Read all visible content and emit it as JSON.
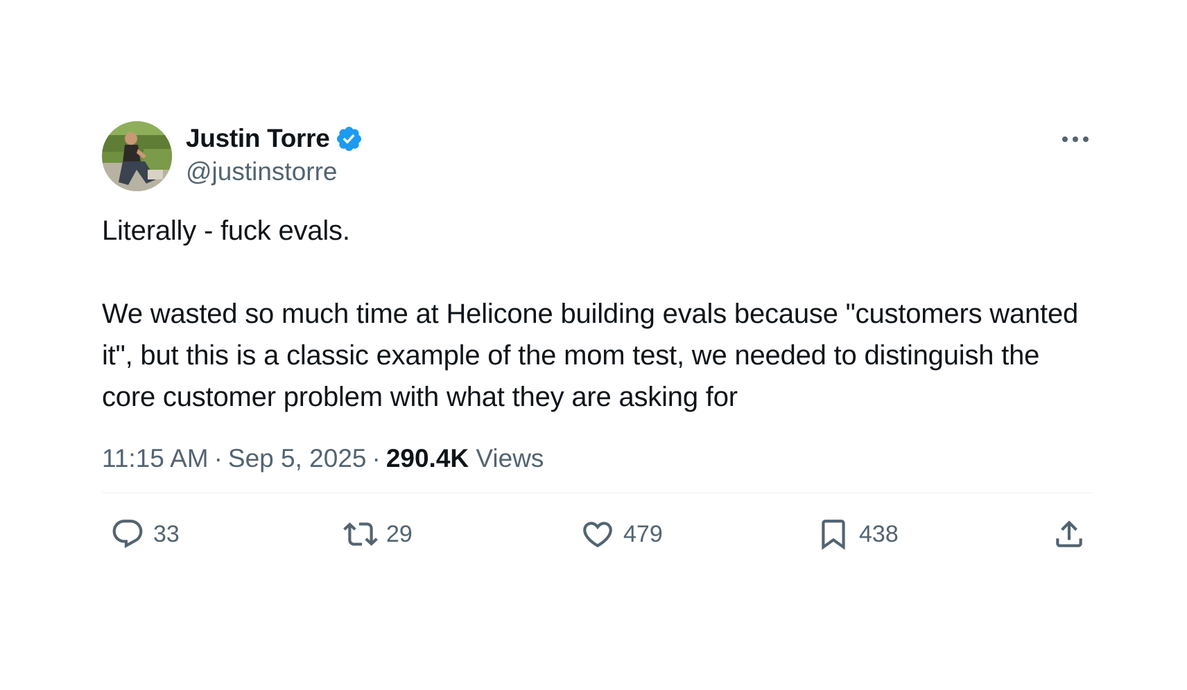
{
  "author": {
    "display_name": "Justin Torre",
    "handle": "@justinstorre",
    "verified_icon": "verified-badge-icon"
  },
  "tweet": {
    "paragraphs": [
      "Literally - fuck evals.",
      "We wasted so much time at Helicone building evals because \"customers wanted it\", but this is a classic example of the mom test, we needed to distinguish the core customer problem with what they are asking for"
    ]
  },
  "meta": {
    "time": "11:15 AM",
    "separator": "·",
    "date": "Sep 5, 2025",
    "views_count": "290.4K",
    "views_label": "Views"
  },
  "actions": {
    "replies": "33",
    "retweets": "29",
    "likes": "479",
    "bookmarks": "438"
  },
  "colors": {
    "text_primary": "#0f1419",
    "text_secondary": "#536471",
    "verified_blue": "#1d9bf0",
    "divider": "#eff3f4"
  }
}
